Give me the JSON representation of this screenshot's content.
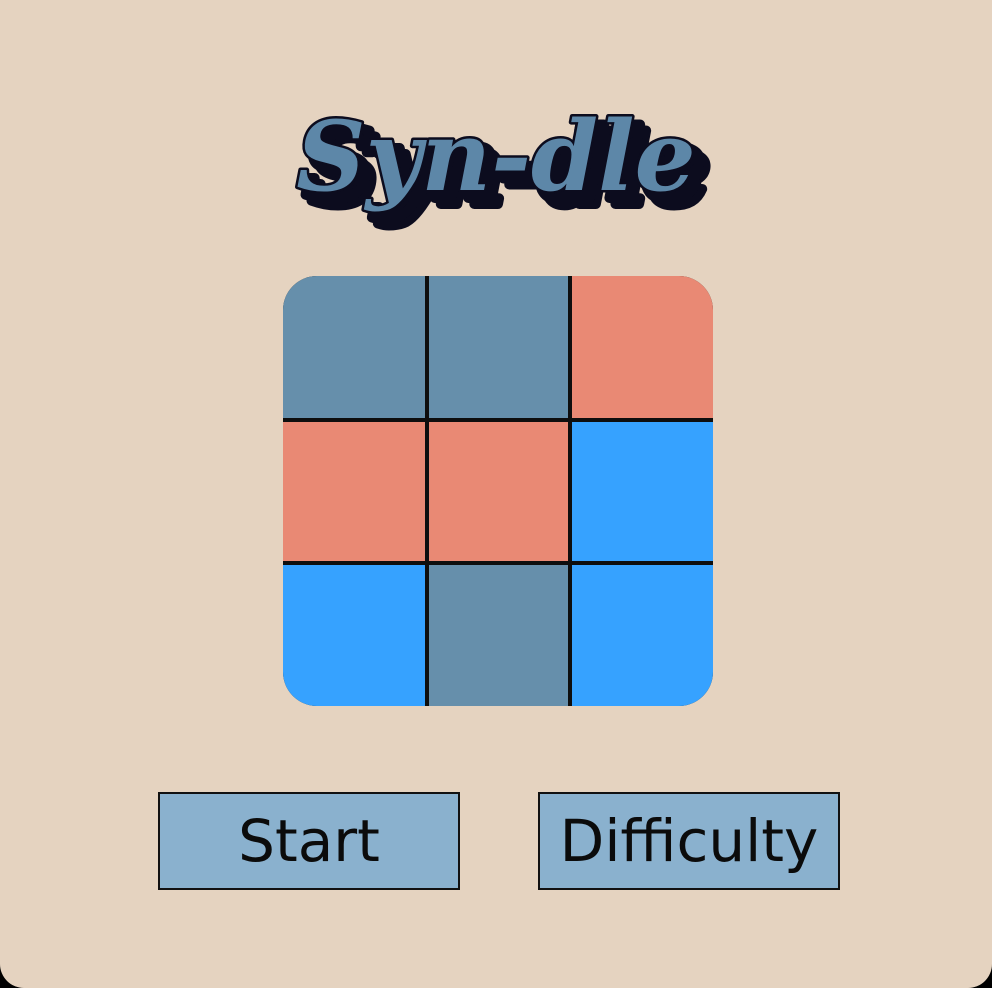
{
  "app": {
    "title": "Syn-dle"
  },
  "colors": {
    "background": "#e5d3c0",
    "slate": "#668fab",
    "salmon": "#e98974",
    "blue": "#36a2ff",
    "button": "#8ab1ce",
    "logo_fill": "#5d87a8",
    "logo_shadow": "#0c0c1e"
  },
  "board": {
    "cells": [
      [
        "slate",
        "slate",
        "salmon"
      ],
      [
        "salmon",
        "salmon",
        "blue"
      ],
      [
        "blue",
        "slate",
        "blue"
      ]
    ]
  },
  "buttons": {
    "start_label": "Start",
    "difficulty_label": "Difficulty"
  }
}
